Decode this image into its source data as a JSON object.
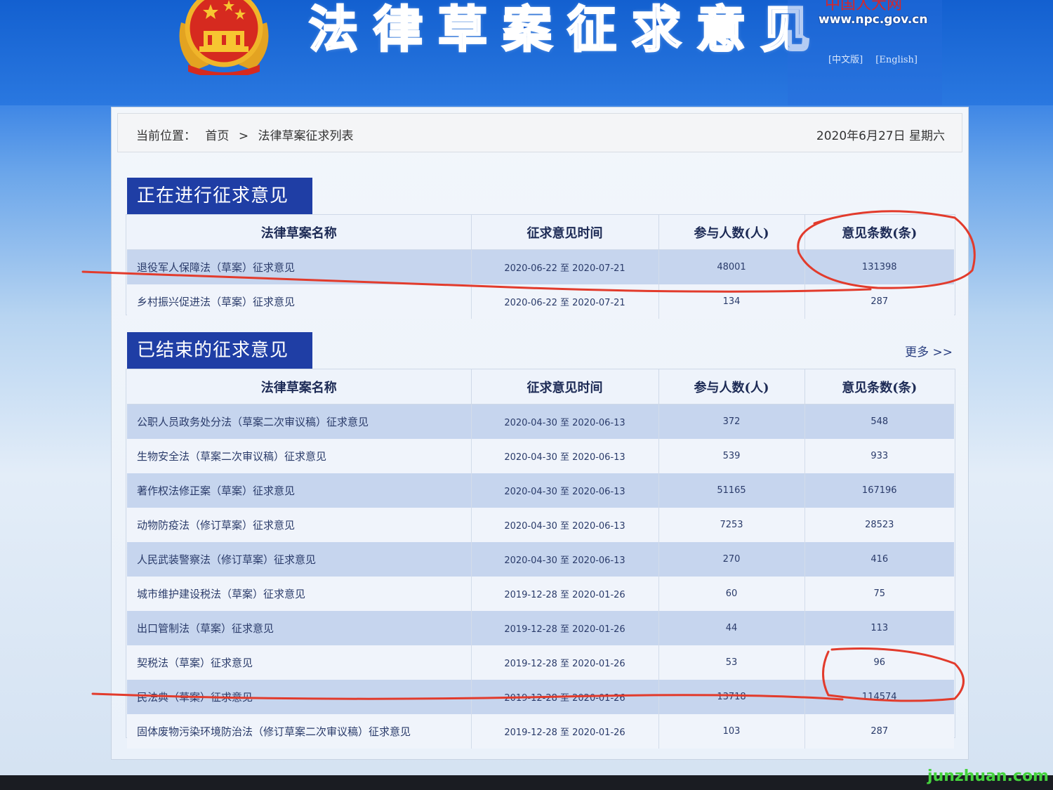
{
  "header": {
    "site_title": "法律草案征求意见",
    "npc_cn": "中国人大网",
    "npc_url": "www.npc.gov.cn",
    "lang_links": [
      "[中文版]",
      "[English]"
    ]
  },
  "breadcrumb": {
    "label": "当前位置：",
    "home": "首页",
    "separator": ">",
    "current": "法律草案征求列表",
    "date": "2020年6月27日  星期六"
  },
  "ongoing": {
    "title": "正在进行征求意见",
    "headers": [
      "法律草案名称",
      "征求意见时间",
      "参与人数(人)",
      "意见条数(条)"
    ],
    "rows": [
      {
        "name": "退役军人保障法（草案）征求意见",
        "period": "2020-06-22 至 2020-07-21",
        "participants": "48001",
        "comments": "131398"
      },
      {
        "name": "乡村振兴促进法（草案）征求意见",
        "period": "2020-06-22 至 2020-07-21",
        "participants": "134",
        "comments": "287"
      }
    ]
  },
  "closed": {
    "title": "已结束的征求意见",
    "more": "更多 >>",
    "headers": [
      "法律草案名称",
      "征求意见时间",
      "参与人数(人)",
      "意见条数(条)"
    ],
    "rows": [
      {
        "name": "公职人员政务处分法（草案二次审议稿）征求意见",
        "period": "2020-04-30 至 2020-06-13",
        "participants": "372",
        "comments": "548"
      },
      {
        "name": "生物安全法（草案二次审议稿）征求意见",
        "period": "2020-04-30 至 2020-06-13",
        "participants": "539",
        "comments": "933"
      },
      {
        "name": "著作权法修正案（草案）征求意见",
        "period": "2020-04-30 至 2020-06-13",
        "participants": "51165",
        "comments": "167196"
      },
      {
        "name": "动物防疫法（修订草案）征求意见",
        "period": "2020-04-30 至 2020-06-13",
        "participants": "7253",
        "comments": "28523"
      },
      {
        "name": "人民武装警察法（修订草案）征求意见",
        "period": "2020-04-30 至 2020-06-13",
        "participants": "270",
        "comments": "416"
      },
      {
        "name": "城市维护建设税法（草案）征求意见",
        "period": "2019-12-28 至 2020-01-26",
        "participants": "60",
        "comments": "75"
      },
      {
        "name": "出口管制法（草案）征求意见",
        "period": "2019-12-28 至 2020-01-26",
        "participants": "44",
        "comments": "113"
      },
      {
        "name": "契税法（草案）征求意见",
        "period": "2019-12-28 至 2020-01-26",
        "participants": "53",
        "comments": "96"
      },
      {
        "name": "民法典（草案）征求意见",
        "period": "2019-12-28 至 2020-01-26",
        "participants": "13718",
        "comments": "114574"
      },
      {
        "name": "固体废物污染环境防治法（修订草案二次审议稿）征求意见",
        "period": "2019-12-28 至 2020-01-26",
        "participants": "103",
        "comments": "287"
      }
    ]
  },
  "watermark": "junzhuan.com",
  "colors": {
    "header_blue": "#1f67d8",
    "section_title_bg": "#1f3ea5",
    "row_highlight": "#c6d5ee",
    "annotation_red": "#e23b2c",
    "watermark_green": "#45d23e"
  }
}
